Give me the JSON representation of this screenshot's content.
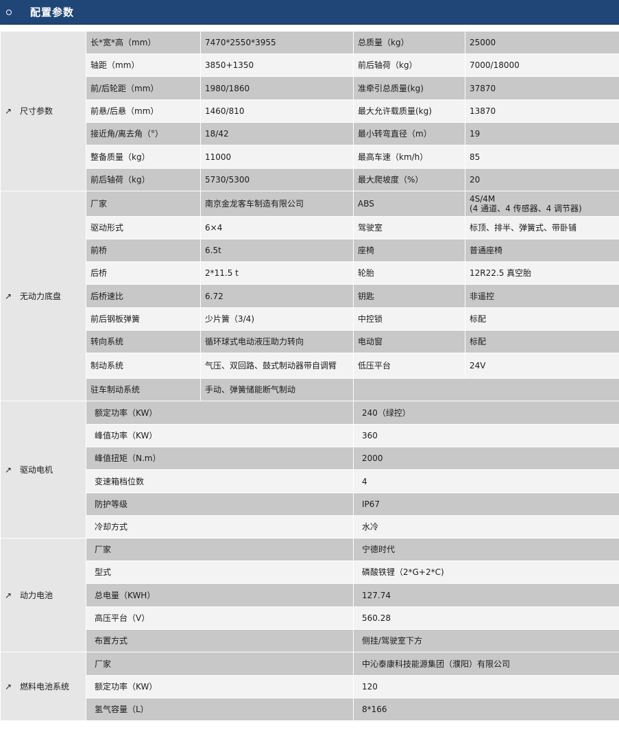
{
  "header": {
    "title": "配置参数"
  },
  "sections": [
    {
      "name": "尺寸参数",
      "rows": [
        [
          "长*宽*高（mm）",
          "7470*2550*3955",
          "总质量（kg）",
          "25000"
        ],
        [
          "轴距（mm）",
          "3850+1350",
          "前后轴荷（kg）",
          "7000/18000"
        ],
        [
          "前/后轮距（mm）",
          "1980/1860",
          "准牵引总质量(kg)",
          "37870"
        ],
        [
          "前悬/后悬（mm）",
          "1460/810",
          "最大允许载质量(kg)",
          "13870"
        ],
        [
          "接近角/离去角（°）",
          "18/42",
          "最小转弯直径（m）",
          "19"
        ],
        [
          "整备质量（kg）",
          "11000",
          "最高车速（km/h）",
          "85"
        ],
        [
          "前后轴荷（kg）",
          "5730/5300",
          "最大爬坡度（%）",
          "20"
        ]
      ]
    },
    {
      "name": "无动力底盘",
      "rows": [
        [
          "厂家",
          "南京金龙客车制造有限公司",
          "ABS",
          "4S/4M\n(4 通道、4 传感器、4 调节器)"
        ],
        [
          "驱动形式",
          "6×4",
          "驾驶室",
          "标顶、排半、弹簧式、带卧铺"
        ],
        [
          "前桥",
          "6.5t",
          "座椅",
          "普通座椅"
        ],
        [
          "后桥",
          "2*11.5 t",
          "轮胎",
          "12R22.5 真空胎"
        ],
        [
          "后桥速比",
          "6.72",
          "钥匙",
          "非遥控"
        ],
        [
          "前后钢板弹簧",
          "少片簧（3/4)",
          "中控锁",
          "标配"
        ],
        [
          "转向系统",
          "循环球式电动液压助力转向",
          "电动窗",
          "标配"
        ],
        [
          "制动系统",
          "气压、双回路、鼓式制动器带自调臂",
          "低压平台",
          "24V"
        ],
        [
          "驻车制动系统",
          "手动、弹簧储能断气制动",
          "",
          ""
        ]
      ]
    },
    {
      "name": "驱动电机",
      "rows": [
        [
          "额定功率（KW）",
          "240（绿控）"
        ],
        [
          "峰值功率（KW）",
          "360"
        ],
        [
          "峰值扭矩（N.m）",
          "2000"
        ],
        [
          "变速箱档位数",
          "4"
        ],
        [
          "防护等级",
          "IP67"
        ],
        [
          "冷却方式",
          "水冷"
        ]
      ]
    },
    {
      "name": "动力电池",
      "rows": [
        [
          "厂家",
          "宁德时代"
        ],
        [
          "型式",
          "磷酸铁锂（2*G+2*C)"
        ],
        [
          "总电量（KWH）",
          "127.74"
        ],
        [
          "高压平台（V）",
          "560.28"
        ],
        [
          "布置方式",
          "侧挂/驾驶室下方"
        ]
      ]
    },
    {
      "name": "燃料电池系统",
      "rows": [
        [
          "厂家",
          "中沁泰康科技能源集团（濮阳）有限公司"
        ],
        [
          "额定功率（KW）",
          "120"
        ],
        [
          "氢气容量（L）",
          "8*166"
        ]
      ]
    }
  ]
}
